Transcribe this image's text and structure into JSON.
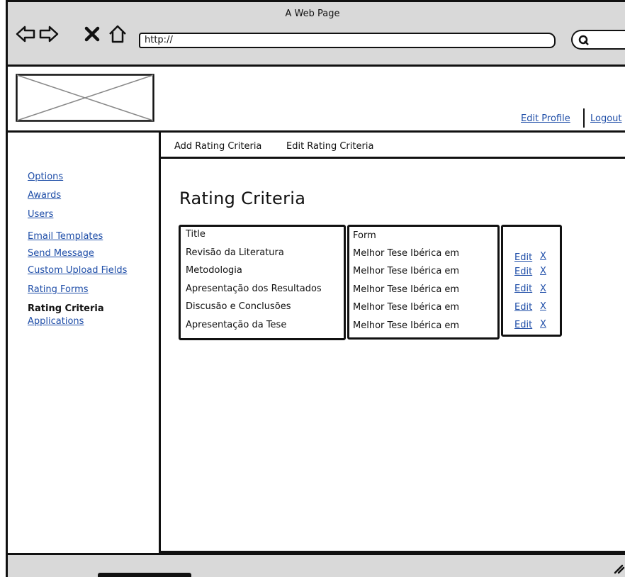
{
  "window": {
    "title": "A Web Page"
  },
  "browser": {
    "url": "http://",
    "nav_icons": [
      "back-arrow-icon",
      "forward-arrow-icon",
      "close-x-icon",
      "home-icon",
      "search-icon"
    ]
  },
  "header": {
    "logo": "image-placeholder",
    "links": {
      "edit_profile": "Edit Profile",
      "logout": "Logout"
    }
  },
  "sidebar": {
    "items": [
      {
        "label": "Options",
        "active": false
      },
      {
        "label": "Awards",
        "active": false
      },
      {
        "label": "Users",
        "active": false
      },
      {
        "label": "Email Templates",
        "active": false
      },
      {
        "label": "Send Message",
        "active": false
      },
      {
        "label": "Custom Upload Fields",
        "active": false
      },
      {
        "label": "Rating Forms",
        "active": false
      },
      {
        "label": "Rating Criteria",
        "active": true
      },
      {
        "label": "Applications",
        "active": false
      }
    ]
  },
  "tabs": {
    "add": "Add Rating Criteria",
    "edit": "Edit Rating Criteria"
  },
  "main": {
    "title": "Rating Criteria",
    "table": {
      "headers": {
        "title": "Title",
        "form": "Form"
      },
      "rows": [
        {
          "title": "Revisão da Literatura",
          "form": "Melhor Tese Ibérica em",
          "edit": "Edit",
          "delete": "X"
        },
        {
          "title": "Metodologia",
          "form": "Melhor Tese Ibérica em",
          "edit": "Edit",
          "delete": "X"
        },
        {
          "title": "Apresentação dos Resultados",
          "form": "Melhor Tese Ibérica em",
          "edit": "Edit",
          "delete": "X"
        },
        {
          "title": "Discusão e Conclusões",
          "form": "Melhor Tese Ibérica em",
          "edit": "Edit",
          "delete": "X"
        },
        {
          "title": "Apresentação da Tese",
          "form": "Melhor Tese Ibérica em",
          "edit": "Edit",
          "delete": "X"
        }
      ]
    }
  },
  "colors": {
    "link": "#1f4ea8",
    "chrome": "#d9d9d9",
    "border": "#111111"
  }
}
